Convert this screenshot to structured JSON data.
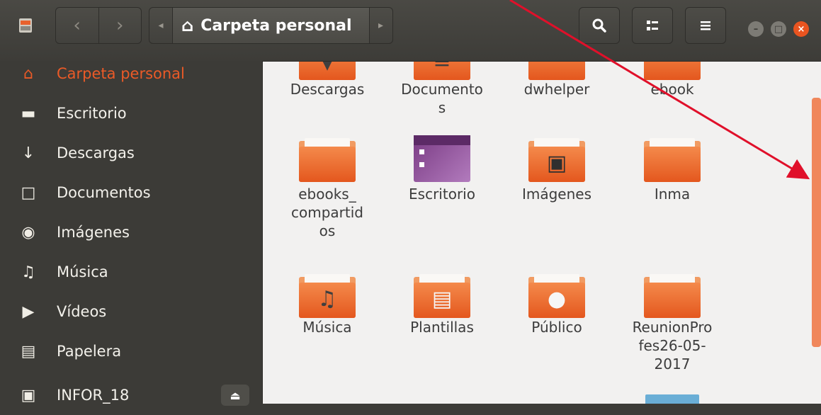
{
  "headerbar": {
    "back_icon": "chevron-left-icon",
    "forward_icon": "chevron-right-icon",
    "path_current": "Carpeta personal",
    "home_icon": "⌂",
    "search_icon": "search-icon",
    "view_icon": "list-view-icon",
    "menu_icon": "hamburger-menu-icon"
  },
  "sidebar": {
    "items": [
      {
        "label": "Carpeta personal",
        "icon": "⌂"
      },
      {
        "label": "Escritorio",
        "icon": "▬"
      },
      {
        "label": "Descargas",
        "icon": "↓"
      },
      {
        "label": "Documentos",
        "icon": "□"
      },
      {
        "label": "Imágenes",
        "icon": "◉"
      },
      {
        "label": "Música",
        "icon": "♫"
      },
      {
        "label": "Vídeos",
        "icon": "▶"
      },
      {
        "label": "Papelera",
        "icon": "▤"
      },
      {
        "label": "INFOR_18",
        "icon": "▣"
      }
    ],
    "eject_icon": "⏏"
  },
  "files": {
    "row1": [
      "Descargas",
      "Documento\ns",
      "dwhelper",
      "ebook"
    ],
    "row2": [
      "ebooks_\ncompartid\nos",
      "Escritorio",
      "Imágenes",
      "Inma"
    ],
    "row3": [
      "Música",
      "Plantillas",
      "Público",
      "ReunionPro\nfes26-05-\n2017"
    ]
  },
  "colors": {
    "accent": "#ea5a27",
    "annotation_arrow": "#e0102a"
  }
}
